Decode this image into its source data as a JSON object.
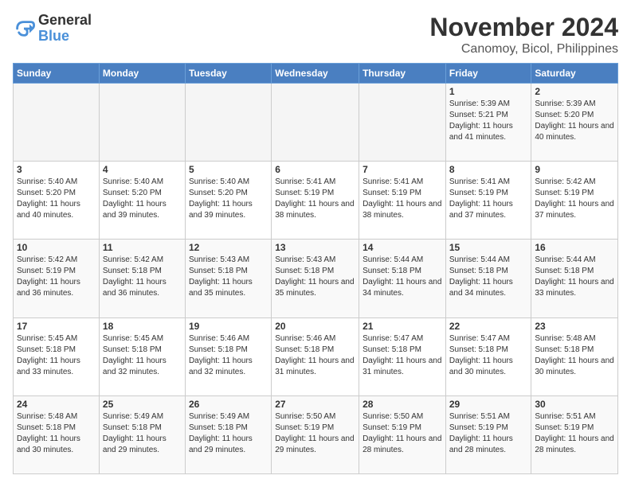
{
  "logo": {
    "line1": "General",
    "line2": "Blue"
  },
  "title": "November 2024",
  "location": "Canomoy, Bicol, Philippines",
  "weekdays": [
    "Sunday",
    "Monday",
    "Tuesday",
    "Wednesday",
    "Thursday",
    "Friday",
    "Saturday"
  ],
  "weeks": [
    [
      {
        "day": "",
        "info": ""
      },
      {
        "day": "",
        "info": ""
      },
      {
        "day": "",
        "info": ""
      },
      {
        "day": "",
        "info": ""
      },
      {
        "day": "",
        "info": ""
      },
      {
        "day": "1",
        "info": "Sunrise: 5:39 AM\nSunset: 5:21 PM\nDaylight: 11 hours and 41 minutes."
      },
      {
        "day": "2",
        "info": "Sunrise: 5:39 AM\nSunset: 5:20 PM\nDaylight: 11 hours and 40 minutes."
      }
    ],
    [
      {
        "day": "3",
        "info": "Sunrise: 5:40 AM\nSunset: 5:20 PM\nDaylight: 11 hours and 40 minutes."
      },
      {
        "day": "4",
        "info": "Sunrise: 5:40 AM\nSunset: 5:20 PM\nDaylight: 11 hours and 39 minutes."
      },
      {
        "day": "5",
        "info": "Sunrise: 5:40 AM\nSunset: 5:20 PM\nDaylight: 11 hours and 39 minutes."
      },
      {
        "day": "6",
        "info": "Sunrise: 5:41 AM\nSunset: 5:19 PM\nDaylight: 11 hours and 38 minutes."
      },
      {
        "day": "7",
        "info": "Sunrise: 5:41 AM\nSunset: 5:19 PM\nDaylight: 11 hours and 38 minutes."
      },
      {
        "day": "8",
        "info": "Sunrise: 5:41 AM\nSunset: 5:19 PM\nDaylight: 11 hours and 37 minutes."
      },
      {
        "day": "9",
        "info": "Sunrise: 5:42 AM\nSunset: 5:19 PM\nDaylight: 11 hours and 37 minutes."
      }
    ],
    [
      {
        "day": "10",
        "info": "Sunrise: 5:42 AM\nSunset: 5:19 PM\nDaylight: 11 hours and 36 minutes."
      },
      {
        "day": "11",
        "info": "Sunrise: 5:42 AM\nSunset: 5:18 PM\nDaylight: 11 hours and 36 minutes."
      },
      {
        "day": "12",
        "info": "Sunrise: 5:43 AM\nSunset: 5:18 PM\nDaylight: 11 hours and 35 minutes."
      },
      {
        "day": "13",
        "info": "Sunrise: 5:43 AM\nSunset: 5:18 PM\nDaylight: 11 hours and 35 minutes."
      },
      {
        "day": "14",
        "info": "Sunrise: 5:44 AM\nSunset: 5:18 PM\nDaylight: 11 hours and 34 minutes."
      },
      {
        "day": "15",
        "info": "Sunrise: 5:44 AM\nSunset: 5:18 PM\nDaylight: 11 hours and 34 minutes."
      },
      {
        "day": "16",
        "info": "Sunrise: 5:44 AM\nSunset: 5:18 PM\nDaylight: 11 hours and 33 minutes."
      }
    ],
    [
      {
        "day": "17",
        "info": "Sunrise: 5:45 AM\nSunset: 5:18 PM\nDaylight: 11 hours and 33 minutes."
      },
      {
        "day": "18",
        "info": "Sunrise: 5:45 AM\nSunset: 5:18 PM\nDaylight: 11 hours and 32 minutes."
      },
      {
        "day": "19",
        "info": "Sunrise: 5:46 AM\nSunset: 5:18 PM\nDaylight: 11 hours and 32 minutes."
      },
      {
        "day": "20",
        "info": "Sunrise: 5:46 AM\nSunset: 5:18 PM\nDaylight: 11 hours and 31 minutes."
      },
      {
        "day": "21",
        "info": "Sunrise: 5:47 AM\nSunset: 5:18 PM\nDaylight: 11 hours and 31 minutes."
      },
      {
        "day": "22",
        "info": "Sunrise: 5:47 AM\nSunset: 5:18 PM\nDaylight: 11 hours and 30 minutes."
      },
      {
        "day": "23",
        "info": "Sunrise: 5:48 AM\nSunset: 5:18 PM\nDaylight: 11 hours and 30 minutes."
      }
    ],
    [
      {
        "day": "24",
        "info": "Sunrise: 5:48 AM\nSunset: 5:18 PM\nDaylight: 11 hours and 30 minutes."
      },
      {
        "day": "25",
        "info": "Sunrise: 5:49 AM\nSunset: 5:18 PM\nDaylight: 11 hours and 29 minutes."
      },
      {
        "day": "26",
        "info": "Sunrise: 5:49 AM\nSunset: 5:18 PM\nDaylight: 11 hours and 29 minutes."
      },
      {
        "day": "27",
        "info": "Sunrise: 5:50 AM\nSunset: 5:19 PM\nDaylight: 11 hours and 29 minutes."
      },
      {
        "day": "28",
        "info": "Sunrise: 5:50 AM\nSunset: 5:19 PM\nDaylight: 11 hours and 28 minutes."
      },
      {
        "day": "29",
        "info": "Sunrise: 5:51 AM\nSunset: 5:19 PM\nDaylight: 11 hours and 28 minutes."
      },
      {
        "day": "30",
        "info": "Sunrise: 5:51 AM\nSunset: 5:19 PM\nDaylight: 11 hours and 28 minutes."
      }
    ]
  ]
}
